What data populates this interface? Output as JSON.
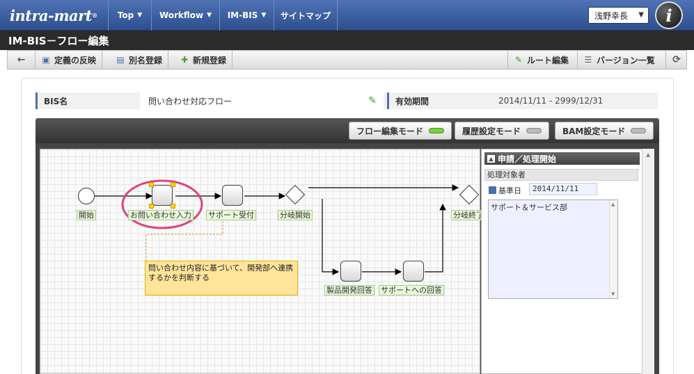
{
  "logo": {
    "text": "intra-mart",
    "mark": "®"
  },
  "nav": {
    "items": [
      {
        "label": "Top"
      },
      {
        "label": "Workflow"
      },
      {
        "label": "IM-BIS"
      },
      {
        "label": "サイトマップ"
      }
    ],
    "user": "浅野幸長",
    "info_icon": "i"
  },
  "page": {
    "title": "IM-BIS－フロー編集"
  },
  "toolbar": {
    "back_icon": "←",
    "reflect": "定義の反映",
    "alias": "別名登録",
    "new": "新規登録",
    "route_edit": "ルート編集",
    "version_list": "バージョン一覧",
    "refresh_icon": "⟳"
  },
  "info": {
    "bis_label": "BIS名",
    "bis_value": "問い合わせ対応フロー",
    "period_label": "有効期間",
    "period_value": "2014/11/11 - 2999/12/31"
  },
  "modes": {
    "flow_edit": "フロー編集モード",
    "history": "履歴設定モード",
    "bam": "BAM設定モード"
  },
  "flow": {
    "labels": {
      "start": "開始",
      "inquiry_input": "お問い合わせ入力",
      "support_receipt": "サポート受付",
      "branch_start": "分岐開始",
      "branch_end": "分岐終了",
      "product_dev_answer": "製品開発回答",
      "support_answer": "サポートへの回答"
    },
    "note": "問い合わせ内容に基づいて、開発部へ連携するかを判断する"
  },
  "props": {
    "header": "申請／処理開始",
    "section": "処理対象者",
    "date_label": "基準日",
    "date_value": "2014/11/11",
    "assignee": "サポート＆サービス部"
  },
  "colors": {
    "nav": "#3f62a4",
    "title": "#2b2b2b",
    "highlight_circle": "#e0427a",
    "led_on": "#7cd13a"
  }
}
